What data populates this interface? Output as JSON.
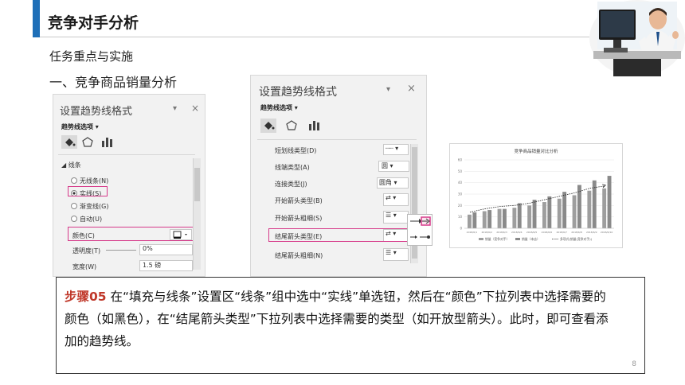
{
  "slide": {
    "title": "竞争对手分析",
    "subtitle1": "任务重点与实施",
    "subtitle2": "一、竞争商品销量分析",
    "page_number": "8"
  },
  "panel_left": {
    "title": "设置趋势线格式",
    "pin": "▾",
    "close": "×",
    "section": "趋势线选项 ▾",
    "group": "线条",
    "options": [
      "无线条(N)",
      "实线(S)",
      "渐变线(G)",
      "自动(U)"
    ],
    "selected_option": "实线(S)",
    "color_label": "颜色(C)",
    "transparency_label": "透明度(T)",
    "transparency_value": "0%",
    "width_label": "宽度(W)",
    "width_value": "1.5 磅"
  },
  "panel_right": {
    "title": "设置趋势线格式",
    "pin": "▾",
    "close": "×",
    "section": "趋势线选项 ▾",
    "rows": [
      {
        "label": "短划线类型(D)",
        "value": "┈┈"
      },
      {
        "label": "线端类型(A)",
        "value": "圆"
      },
      {
        "label": "连接类型(J)",
        "value": "圆角"
      },
      {
        "label": "开始箭头类型(B)",
        "value": "⇄"
      },
      {
        "label": "开始箭头粗细(S)",
        "value": "☰"
      },
      {
        "label": "结尾箭头类型(E)",
        "value": "⇄"
      },
      {
        "label": "结尾箭头粗细(N)",
        "value": "☰"
      }
    ]
  },
  "chart_data": {
    "type": "bar",
    "title": "竞争商品销量对比分析",
    "categories": [
      "2018/6/1",
      "2018/6/2",
      "2018/6/3",
      "2018/6/4",
      "2018/6/5",
      "2018/6/6",
      "2018/6/7",
      "2018/6/8",
      "2018/6/9",
      "2018/6/10"
    ],
    "series": [
      {
        "name": "销量（竞争对手）",
        "values": [
          12,
          15,
          17,
          18,
          20,
          23,
          26,
          29,
          33,
          35
        ],
        "color": "#9e9e9e"
      },
      {
        "name": "销量（本店）",
        "values": [
          14,
          16,
          17,
          22,
          25,
          28,
          32,
          38,
          42,
          46
        ],
        "color": "#8a8a8a"
      }
    ],
    "trendline_name": "多项式(销量(竞争对手))",
    "ylim": [
      0,
      60
    ],
    "yticks": [
      0,
      10,
      20,
      30,
      40,
      50,
      60
    ],
    "xlabel": "",
    "ylabel": "",
    "legend_position": "bottom"
  },
  "step": {
    "label": "步骤05",
    "text": " 在“填充与线条”设置区“线条”组中选中“实线”单选钮，然后在“颜色”下拉列表中选择需要的颜色（如黑色），在“结尾箭头类型”下拉列表中选择需要的类型（如开放型箭头）。此时，即可查看添加的趋势线。"
  }
}
